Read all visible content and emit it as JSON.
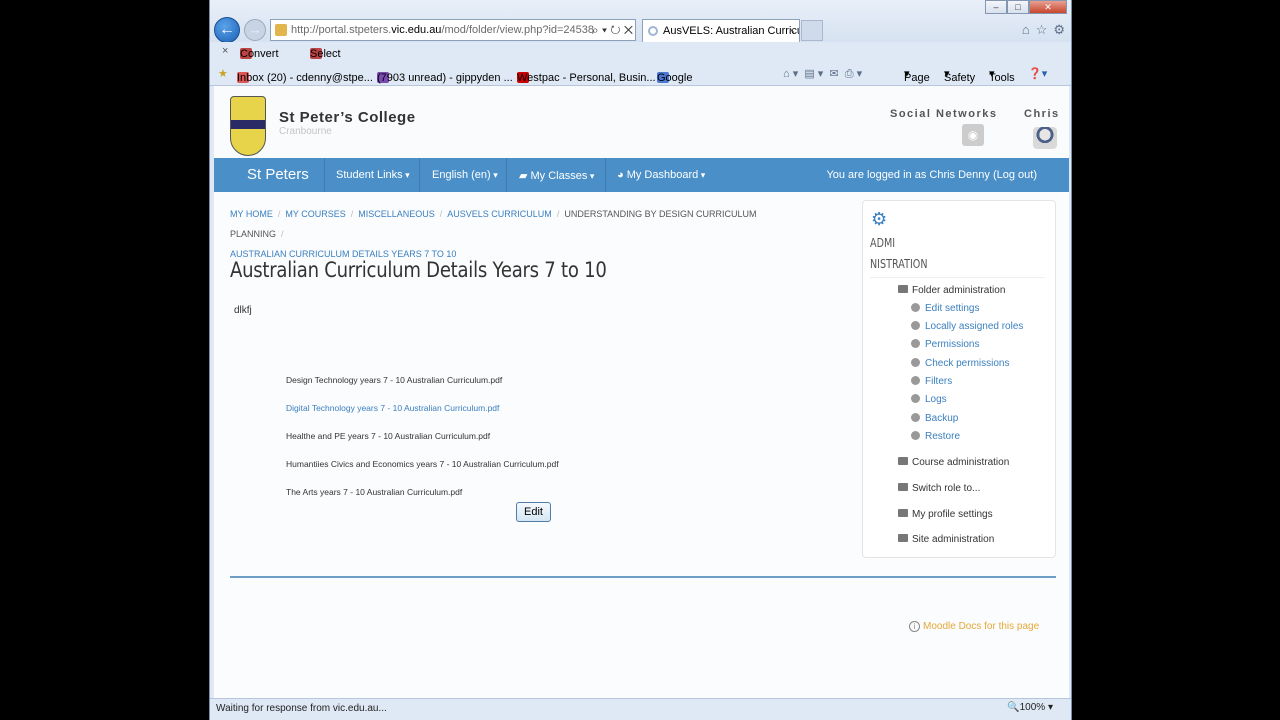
{
  "browser": {
    "url_prefix": "http://portal.stpeters.",
    "url_host": "vic.edu.au",
    "url_suffix": "/mod/folder/view.php?id=24538",
    "tab_title": "AusVELS: Australian Curricu...",
    "tab_close": "×",
    "cmd_convert": "Convert",
    "cmd_select": "Select",
    "favorites": [
      "Inbox (20) - cdenny@stpe...",
      "(7903 unread) - gippyden ...",
      "Westpac - Personal, Busin...",
      "Google"
    ],
    "toolbar": [
      "Page",
      "Safety",
      "Tools"
    ],
    "status": "Waiting for response from vic.edu.au...",
    "zoom": "100%"
  },
  "site": {
    "name": "St Peter’s College",
    "subtitle": "Cranbourne",
    "social_label": "Social Networks",
    "user_label": "Chris"
  },
  "nav": {
    "brand": "St Peters",
    "items": [
      "Student Links",
      "English (en)",
      "My Classes",
      "My Dashboard"
    ],
    "login_text": "You are logged in as Chris Denny (Log out)"
  },
  "breadcrumb": [
    "My home",
    "My courses",
    "Miscellaneous",
    "AusVELS Curriculum",
    "Understanding By Design Curriculum Planning",
    "Australian Curriculum Details Years 7 to 10"
  ],
  "page": {
    "title": "Australian Curriculum Details Years 7 to 10",
    "intro": "dlkfj",
    "files": [
      "Design Technology years 7 - 10 Australian Curriculum.pdf",
      "Digital Technology years 7 - 10 Australian Curriculum.pdf",
      "Healthe and PE years 7 - 10 Australian Curriculum.pdf",
      "Humantiies Civics and Economics years 7 - 10 Australian Curriculum.pdf",
      "The Arts years 7 - 10 Australian Curriculum.pdf"
    ],
    "edit_label": "Edit"
  },
  "admin": {
    "title_line1": "ADMI",
    "title_line2": "NISTRATION",
    "folder_admin": "Folder administration",
    "folder_items": [
      "Edit settings",
      "Locally assigned roles",
      "Permissions",
      "Check permissions",
      "Filters",
      "Logs",
      "Backup",
      "Restore"
    ],
    "sections": [
      "Course administration",
      "Switch role to...",
      "My profile settings",
      "Site administration"
    ]
  },
  "footer": {
    "docs_link": "Moodle Docs for this page"
  }
}
